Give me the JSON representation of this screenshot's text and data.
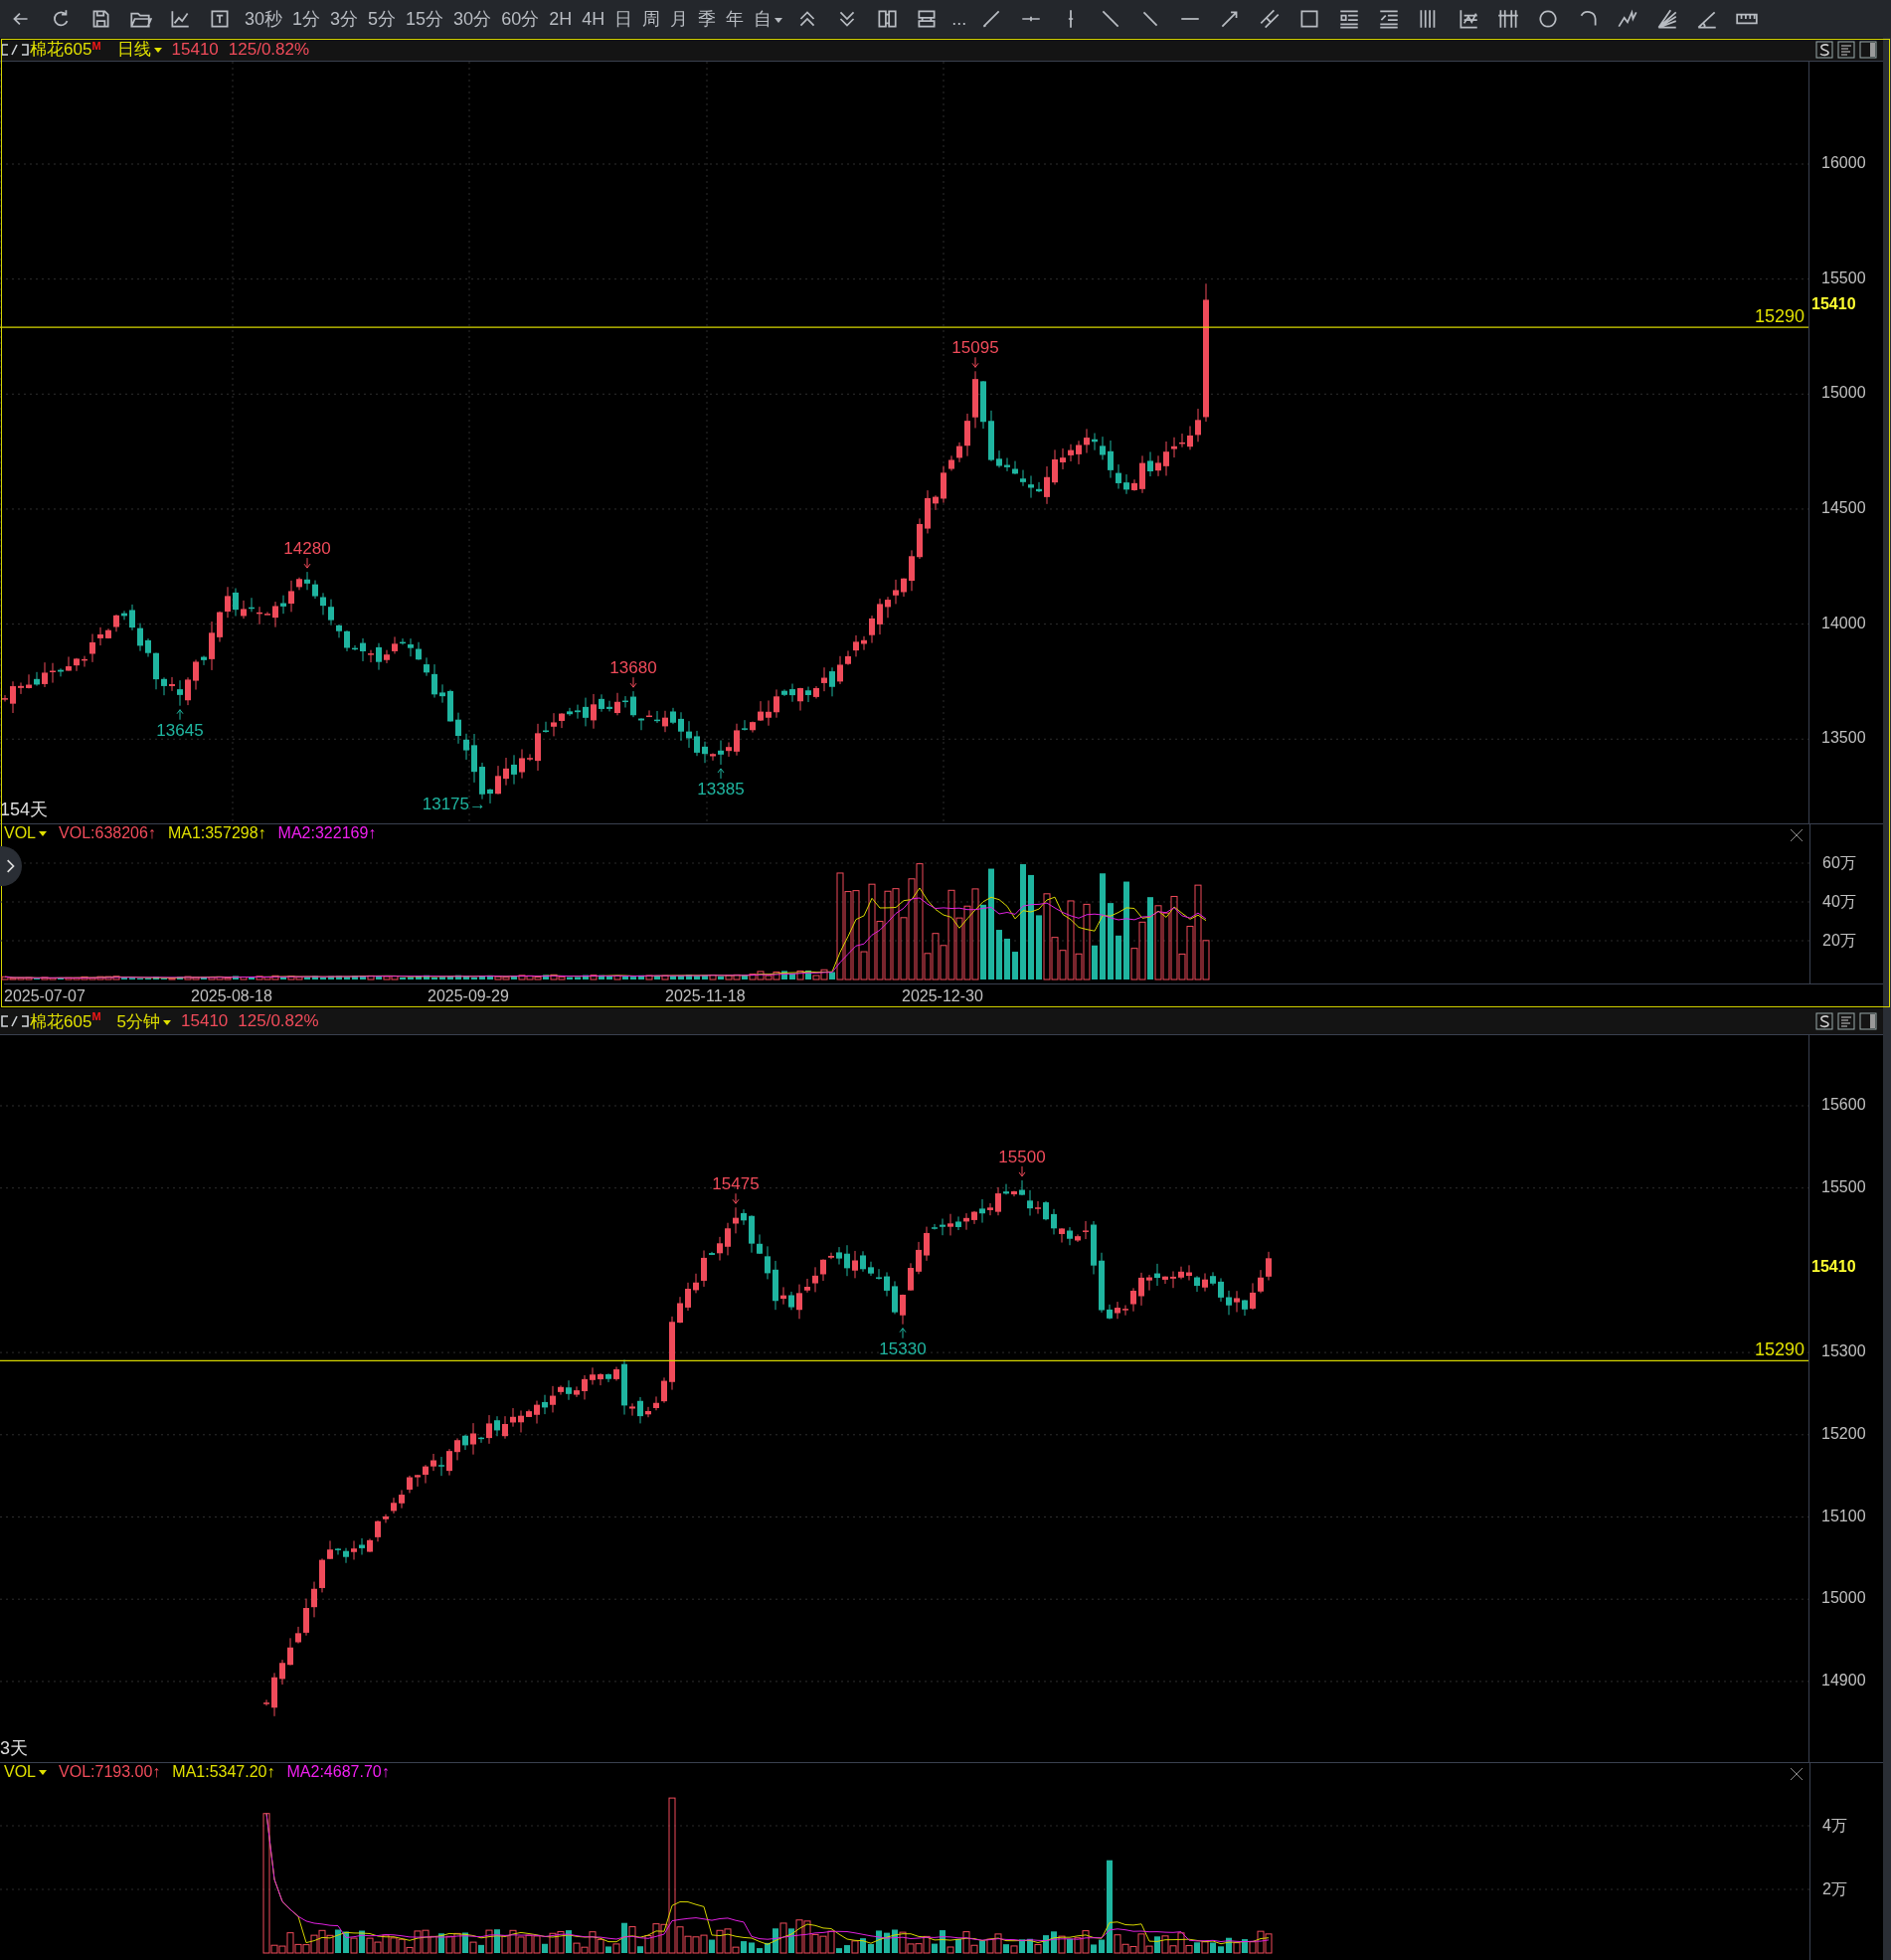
{
  "toolbar": {
    "periods": [
      "30秒",
      "1分",
      "3分",
      "5分",
      "15分",
      "30分",
      "60分",
      "2H",
      "4H",
      "日",
      "周",
      "月",
      "季",
      "年"
    ],
    "custom": "自",
    "more": "..."
  },
  "panels": [
    {
      "selected": true,
      "symbol": "棉花605",
      "badge": "M",
      "period": "日线",
      "price": "15410",
      "change": "125/0.82%",
      "span": "154天",
      "yticks": [
        "16000",
        "15500",
        "15000",
        "14500",
        "14000",
        "13500"
      ],
      "current": "15410",
      "line_label": "15290",
      "markers": [
        {
          "text": "13645",
          "kind": "low"
        },
        {
          "text": "14280",
          "kind": "high"
        },
        {
          "text": "13175→",
          "kind": "side"
        },
        {
          "text": "13680",
          "kind": "high"
        },
        {
          "text": "13385",
          "kind": "low"
        },
        {
          "text": "15095",
          "kind": "high"
        }
      ],
      "volume": {
        "name": "VOL",
        "vol": "VOL:638206↑",
        "ma1": "MA1:357298↑",
        "ma2": "MA2:322169↑",
        "ticks": [
          "60万",
          "40万",
          "20万"
        ]
      },
      "dates": [
        "2025-07-07",
        "2025-08-18",
        "2025-09-29",
        "2025-11-18",
        "2025-12-30"
      ]
    },
    {
      "selected": false,
      "symbol": "棉花605",
      "badge": "M",
      "period": "5分钟",
      "price": "15410",
      "change": "125/0.82%",
      "span": "3天",
      "yticks": [
        "15600",
        "15500",
        "15300",
        "15200",
        "15100",
        "15000",
        "14900"
      ],
      "current": "15410",
      "line_label": "15290",
      "markers": [
        {
          "text": "15475",
          "kind": "high"
        },
        {
          "text": "15330",
          "kind": "low"
        },
        {
          "text": "15500",
          "kind": "high"
        }
      ],
      "volume": {
        "name": "VOL",
        "vol": "VOL:7193.00↑",
        "ma1": "MA1:5347.20↑",
        "ma2": "MA2:4687.70↑",
        "ticks": [
          "4万",
          "2万"
        ]
      }
    }
  ]
}
